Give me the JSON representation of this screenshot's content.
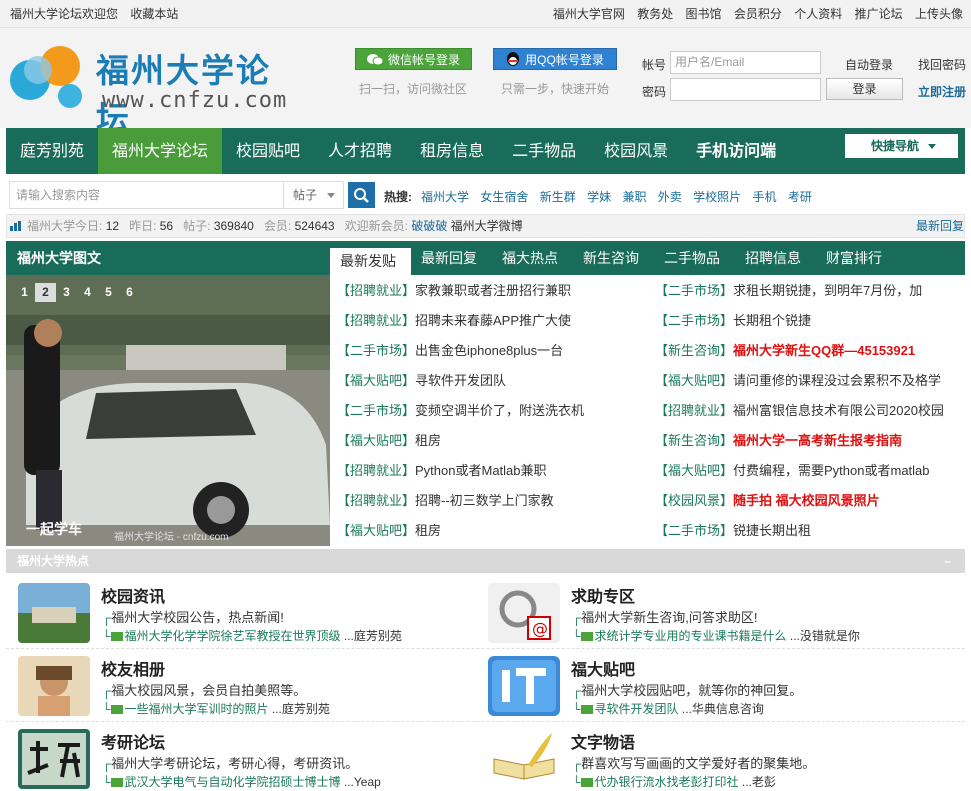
{
  "topbar": {
    "welcome": "福州大学论坛欢迎您",
    "bookmark": "收藏本站",
    "links": [
      "福州大学官网",
      "教务处",
      "图书馆",
      "会员积分",
      "个人资料",
      "推广论坛",
      "上传头像"
    ]
  },
  "header": {
    "logo_title": "福州大学论坛",
    "logo_url": "www.cnfzu.com",
    "wechat_login": "微信帐号登录",
    "wechat_sub": "扫一扫，访问微社区",
    "qq_login": "用QQ帐号登录",
    "qq_sub": "只需一步，快速开始",
    "account_label": "帐号",
    "account_placeholder": "用户名/Email",
    "auto_login": "自动登录",
    "find_password": "找回密码",
    "password_label": "密码",
    "login_button": "登录",
    "register": "立即注册"
  },
  "nav": {
    "items": [
      "庭芳别苑",
      "福州大学论坛",
      "校园贴吧",
      "人才招聘",
      "租房信息",
      "二手物品",
      "校园风景",
      "手机访问端"
    ],
    "active_index": 1,
    "quick_nav": "快捷导航"
  },
  "search": {
    "placeholder": "请输入搜索内容",
    "type": "帖子",
    "hot_label": "热搜:",
    "hot_terms": [
      "福州大学",
      "女生宿舍",
      "新生群",
      "学妹",
      "兼职",
      "外卖",
      "学校照片",
      "手机",
      "考研"
    ]
  },
  "stats": {
    "today_label": "福州大学今日:",
    "today": "12",
    "yesterday_label": "昨日:",
    "yesterday": "56",
    "posts_label": "帖子:",
    "posts": "369840",
    "members_label": "会员:",
    "members": "524643",
    "new_member_label": "欢迎新会员:",
    "new_member": "破破破",
    "weibo": "福州大学微博",
    "latest_reply": "最新回复"
  },
  "picture_panel": {
    "title": "福州大学图文",
    "pages": [
      "1",
      "2",
      "3",
      "4",
      "5",
      "6"
    ],
    "active_page": "2",
    "caption": "一起学车",
    "watermark": "福州大学论坛 - cnfzu.com"
  },
  "tabs": [
    "最新发贴",
    "最新回复",
    "福大热点",
    "新生咨询",
    "二手物品",
    "招聘信息",
    "财富排行"
  ],
  "posts": [
    [
      {
        "cat": "【招聘就业】",
        "title": "家教兼职或者注册招行兼职",
        "red": false
      },
      {
        "cat": "【二手市场】",
        "title": "求租长期锐捷，到明年7月份，加",
        "red": false
      }
    ],
    [
      {
        "cat": "【招聘就业】",
        "title": "招聘未来春藤APP推广大使",
        "red": false
      },
      {
        "cat": "【二手市场】",
        "title": "长期租个锐捷",
        "red": false
      }
    ],
    [
      {
        "cat": "【二手市场】",
        "title": "出售金色iphone8plus一台",
        "red": false
      },
      {
        "cat": "【新生咨询】",
        "title": "福州大学新生QQ群—45153921",
        "red": true
      }
    ],
    [
      {
        "cat": "【福大贴吧】",
        "title": "寻软件开发团队",
        "red": false
      },
      {
        "cat": "【福大贴吧】",
        "title": "请问重修的课程没过会累积不及格学",
        "red": false
      }
    ],
    [
      {
        "cat": "【二手市场】",
        "title": "变频空调半价了，附送洗衣机",
        "red": false
      },
      {
        "cat": "【招聘就业】",
        "title": "福州富银信息技术有限公司2020校园",
        "red": false
      }
    ],
    [
      {
        "cat": "【福大贴吧】",
        "title": "租房",
        "red": false
      },
      {
        "cat": "【新生咨询】",
        "title": "福州大学一高考新生报考指南",
        "red": true
      }
    ],
    [
      {
        "cat": "【招聘就业】",
        "title": "Python或者Matlab兼职",
        "red": false
      },
      {
        "cat": "【福大贴吧】",
        "title": "付费编程，需要Python或者matlab",
        "red": false
      }
    ],
    [
      {
        "cat": "【招聘就业】",
        "title": "招聘--初三数学上门家教",
        "red": false
      },
      {
        "cat": "【校园风景】",
        "title": "随手拍 福大校园风景照片",
        "red": true
      }
    ],
    [
      {
        "cat": "【福大贴吧】",
        "title": "租房",
        "red": false
      },
      {
        "cat": "【二手市场】",
        "title": "锐捷长期出租",
        "red": false
      }
    ]
  ],
  "hot_section": {
    "title": "福州大学热点",
    "minimize": "–"
  },
  "forums": [
    {
      "name": "校园资讯",
      "desc": "福州大学校园公告，热点新闻!",
      "latest": "福州大学化学学院徐艺军教授在世界顶级",
      "author": "庭芳别苑",
      "icon": "campus-photo-icon"
    },
    {
      "name": "求助专区",
      "desc": "福州大学新生咨询,问答求助区!",
      "latest": "求统计学专业用的专业课书籍是什么",
      "author": "没错就是你",
      "icon": "help-magnifier-icon"
    },
    {
      "name": "校友相册",
      "desc": "福大校园风景，会员自拍美照等。",
      "latest": "一些福州大学军训时的照片",
      "author": "庭芳别苑",
      "icon": "album-photo-icon"
    },
    {
      "name": "福大贴吧",
      "desc": "福州大学校园贴吧，就等你的神回复。",
      "latest": "寻软件开发团队",
      "author": "华典信息咨询",
      "icon": "tieba-icon"
    },
    {
      "name": "考研论坛",
      "desc": "福州大学考研论坛，考研心得，考研资讯。",
      "latest": "武汉大学电气与自动化学院招硕士博士博",
      "author": "Yeap",
      "icon": "kaoyan-calligraphy-icon"
    },
    {
      "name": "文字物语",
      "desc": "群喜欢写写画画的文学爱好者的聚集地。",
      "latest": "代办银行流水找老彭打印社",
      "author": "老彭",
      "icon": "book-quill-icon"
    }
  ]
}
